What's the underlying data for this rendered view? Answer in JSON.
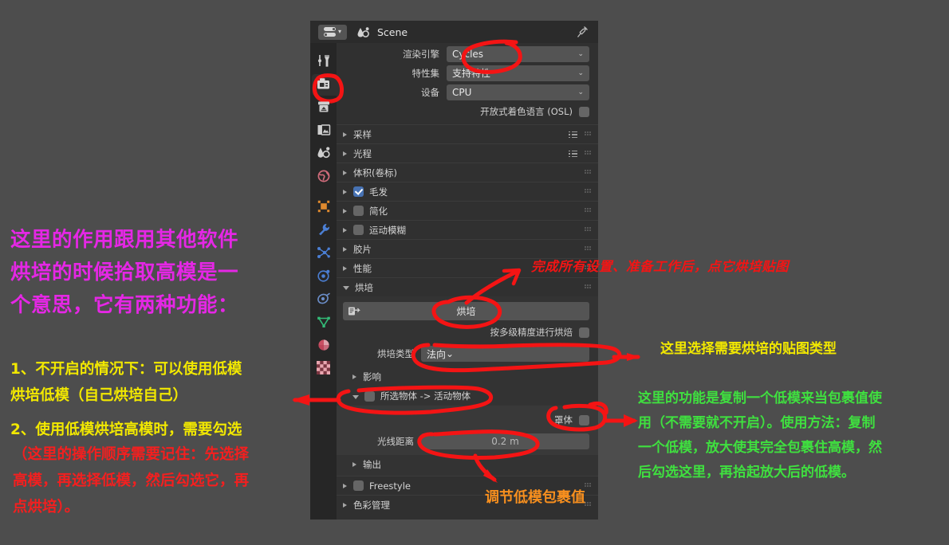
{
  "window": {
    "editor_type": "properties-editor",
    "scene_name": "Scene",
    "pin_icon": "pin-icon"
  },
  "tabs": [
    {
      "name": "tool",
      "icon": "tool-icon",
      "active": false
    },
    {
      "name": "render",
      "icon": "camera-back-icon",
      "active": true
    },
    {
      "name": "output",
      "icon": "printer-icon",
      "active": false
    },
    {
      "name": "view-layer",
      "icon": "images-icon",
      "active": false
    },
    {
      "name": "scene",
      "icon": "scene-cone-icon",
      "active": false
    },
    {
      "name": "world",
      "icon": "world-globe-icon",
      "active": false
    },
    {
      "name": "object",
      "icon": "object-square-icon",
      "active": false
    },
    {
      "name": "modifiers",
      "icon": "wrench-icon",
      "active": false
    },
    {
      "name": "particles",
      "icon": "particles-icon",
      "active": false
    },
    {
      "name": "physics",
      "icon": "physics-orbit-icon",
      "active": false
    },
    {
      "name": "constraints",
      "icon": "constraint-icon",
      "active": false
    },
    {
      "name": "data",
      "icon": "mesh-triangle-icon",
      "active": false
    },
    {
      "name": "material",
      "icon": "material-sphere-icon",
      "active": false
    },
    {
      "name": "texture",
      "icon": "checker-texture-icon",
      "active": false
    }
  ],
  "render_props": [
    {
      "label": "渲染引擎",
      "value": "Cycles"
    },
    {
      "label": "特性集",
      "value": "支持特性"
    },
    {
      "label": "设备",
      "value": "CPU"
    }
  ],
  "osl": {
    "label": "开放式着色语言 (OSL)",
    "checked": false
  },
  "sections": [
    {
      "label": "采样",
      "open": false,
      "checkbox": null,
      "list_icon": true,
      "dots": true
    },
    {
      "label": "光程",
      "open": false,
      "checkbox": null,
      "list_icon": true,
      "dots": true
    },
    {
      "label": "体积(卷标)",
      "open": false,
      "checkbox": null,
      "list_icon": false,
      "dots": true
    },
    {
      "label": "毛发",
      "open": false,
      "checkbox": true,
      "list_icon": false,
      "dots": true
    },
    {
      "label": "简化",
      "open": false,
      "checkbox": false,
      "list_icon": false,
      "dots": true
    },
    {
      "label": "运动模糊",
      "open": false,
      "checkbox": false,
      "list_icon": false,
      "dots": true
    },
    {
      "label": "胶片",
      "open": false,
      "checkbox": null,
      "list_icon": false,
      "dots": true
    },
    {
      "label": "性能",
      "open": false,
      "checkbox": null,
      "list_icon": false,
      "dots": true
    }
  ],
  "bake": {
    "header_label": "烘培",
    "button_label": "烘培",
    "multires_label": "按多级精度进行烘焙",
    "multires_checked": false,
    "type_label": "烘培类型",
    "type_value": "法向",
    "influence_label": "影响",
    "selected_to_active_label": "所选物体 -> 活动物体",
    "selected_to_active_checked": false,
    "cage_label": "罩体",
    "cage_checked": false,
    "ray_distance_label": "光线距离",
    "ray_distance_value": "0.2 m",
    "output_label": "输出"
  },
  "bottom_sections": [
    {
      "label": "Freestyle",
      "checkbox": false,
      "dots": true
    },
    {
      "label": "色彩管理",
      "checkbox": null,
      "dots": true
    }
  ],
  "annotations": {
    "left_title": "这里的作用跟用其他软件\n烘培的时候拾取高模是一\n个意思，它有两种功能：",
    "left_point1": "1、不开启的情况下：可以使用低模\n烘培低模（自己烘培自己）",
    "left_point2": "2、使用低模烘培高模时，需要勾选",
    "left_point2_red": "（这里的操作顺序需要记住：先选择\n高模，再选择低模，然后勾选它，再\n点烘培）。",
    "top_red": "完成所有设置、准备工作后，点它烘培贴图",
    "right_yellow": "这里选择需要烘培的贴图类型",
    "orange": "调节低模包裹值",
    "right_green": "这里的功能是复制一个低模来当包裹值使\n用（不需要就不开启）。使用方法：复制\n一个低模，放大使其完全包裹住高模，然\n后勾选这里，再拾起放大后的低模。"
  },
  "colors": {
    "background": "#4d4d4d",
    "panel_bg": "#303030",
    "annotation_red": "#f41414",
    "annotation_yellow": "#f2e800",
    "annotation_green": "#3fe03f",
    "annotation_magenta": "#e527e5",
    "annotation_orange": "#f78f1e",
    "accent_blue": "#4772b3"
  }
}
